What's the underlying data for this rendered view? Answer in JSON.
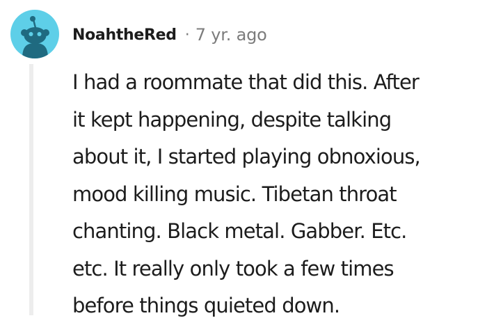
{
  "comment": {
    "username": "NoahtheRed",
    "separator": "·",
    "time": "7 yr. ago",
    "avatar_icon": "reddit-snoo-avatar-icon",
    "avatar_color": "#5ecfe8",
    "body_lines": [
      "I had a roommate that did this. After",
      "it kept happening, despite talking",
      "about it, I started playing obnoxious,",
      "mood killing music. Tibetan throat",
      "chanting. Black metal. Gabber. Etc.",
      "etc. It really only took a few times",
      "before things quieted down."
    ]
  }
}
